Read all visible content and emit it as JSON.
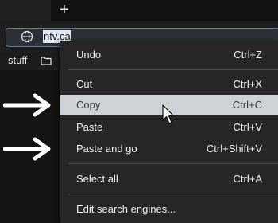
{
  "tabstrip": {
    "new_tab_symbol": "+"
  },
  "omnibox": {
    "icon": "globe-icon",
    "url_text": "ntv.ca"
  },
  "bookmarks": {
    "folder_label": "stuff",
    "folder_icon": "folder-icon"
  },
  "page": {
    "arrow_icon": "right-arrow-icon"
  },
  "context_menu": {
    "items": [
      {
        "label": "Undo",
        "shortcut": "Ctrl+Z"
      },
      {
        "label": "Cut",
        "shortcut": "Ctrl+X"
      },
      {
        "label": "Copy",
        "shortcut": "Ctrl+C",
        "highlighted": true
      },
      {
        "label": "Paste",
        "shortcut": "Ctrl+V"
      },
      {
        "label": "Paste and go",
        "shortcut": "Ctrl+Shift+V"
      },
      {
        "label": "Select all",
        "shortcut": "Ctrl+A"
      },
      {
        "label": "Edit search engines...",
        "shortcut": ""
      }
    ]
  },
  "colors": {
    "menu_background": "#262626",
    "highlight": "#cfd3d7",
    "selection": "#dfe7f1",
    "arrow": "#ffffff"
  }
}
